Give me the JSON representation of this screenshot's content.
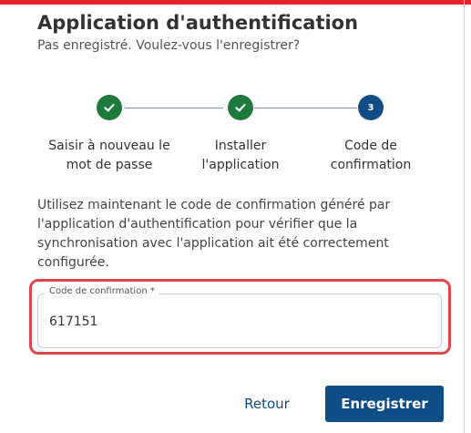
{
  "header": {
    "title": "Application d'authentification",
    "subtitle": "Pas enregistré. Voulez-vous l'enregistrer?"
  },
  "stepper": {
    "steps": [
      {
        "status": "done",
        "icon": "check-icon",
        "label_line1": "Saisir à nouveau le",
        "label_line2": "mot de passe"
      },
      {
        "status": "done",
        "icon": "check-icon",
        "label_line1": "Installer",
        "label_line2": "l'application"
      },
      {
        "status": "current",
        "number": "3",
        "label_line1": "Code de",
        "label_line2": "confirmation"
      }
    ]
  },
  "instructions": {
    "text": "Utilisez maintenant le code de confirmation généré par l'application d'authentification pour vérifier que la synchronisation avec l'application ait été correctement configurée."
  },
  "confirmation_field": {
    "label": "Code de confirmation *",
    "value": "617151"
  },
  "actions": {
    "back_label": "Retour",
    "save_label": "Enregistrer"
  },
  "colors": {
    "primary": "#0f4d86",
    "success": "#1f7a3e",
    "highlight": "#e0464e",
    "top_bar": "#e8232a"
  }
}
